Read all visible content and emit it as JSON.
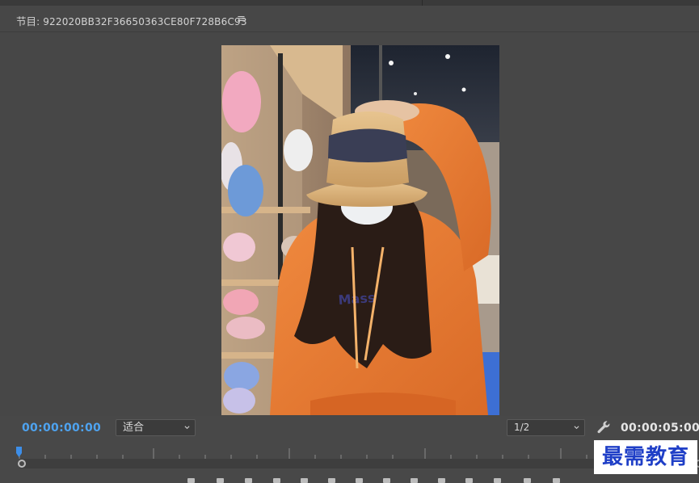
{
  "panel": {
    "label": "节目:",
    "sequence_name": "922020BB32F36650363CE80F728B6C93",
    "menu_icon": "hamburger-menu-icon"
  },
  "controls": {
    "current_timecode": "00:00:00:00",
    "zoom_select": {
      "value": "适合"
    },
    "resolution_select": {
      "value": "1/2"
    },
    "settings_icon": "wrench-icon",
    "duration_timecode": "00:00:05:00"
  },
  "timeline": {
    "playhead_position": 0
  },
  "watermark": {
    "text": "最需教育"
  },
  "colors": {
    "background": "#484848",
    "accent_timecode": "#4ea3f0",
    "watermark_text": "#1f3fc7"
  }
}
